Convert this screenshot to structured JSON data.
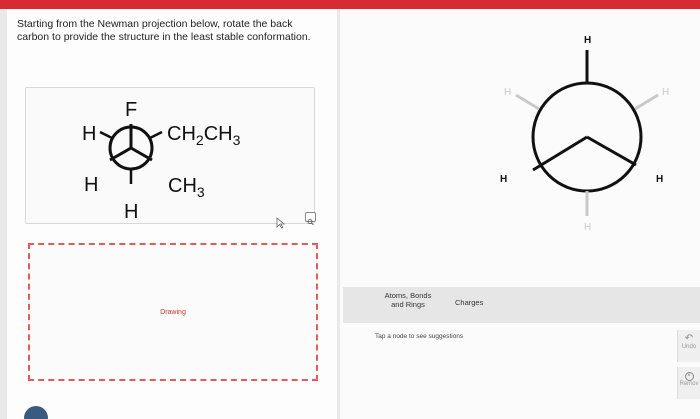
{
  "question": {
    "line1": "Starting from the Newman projection below, rotate the back",
    "line2": "carbon to provide the structure in the least stable conformation."
  },
  "newman": {
    "front_top": "F",
    "left_upper": "H",
    "left_lower": "H",
    "bottom": "H",
    "right_upper_main": "CH",
    "right_upper_sub": "2",
    "right_upper_main2": "CH",
    "right_upper_sub2": "3",
    "right_lower_main": "CH",
    "right_lower_sub": "3"
  },
  "drawing": {
    "label": "Drawing"
  },
  "editor": {
    "top": "H",
    "upper_left": "H",
    "upper_right": "H",
    "lower_left": "H",
    "lower_right": "H",
    "bottom": "H"
  },
  "toolbar": {
    "atoms_line1": "Atoms, Bonds",
    "atoms_line2": "and Rings",
    "charges": "Charges"
  },
  "hint": "Tap a node to see suggestions",
  "side_buttons": {
    "undo": "Undo",
    "remove": "Remov"
  },
  "colors": {
    "top_bar": "#d72b34",
    "drawing_border": "#e35a5a"
  }
}
